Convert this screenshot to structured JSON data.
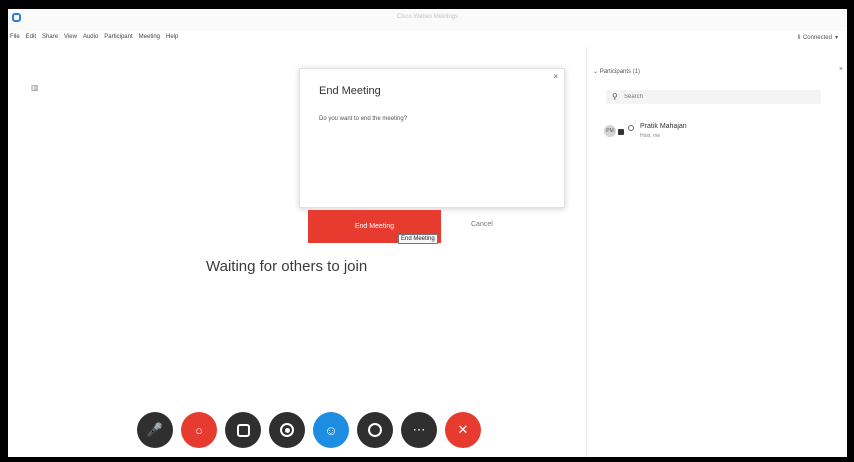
{
  "window": {
    "title": "Cisco Webex Meetings"
  },
  "menu": {
    "items": [
      "File",
      "Edit",
      "Share",
      "View",
      "Audio",
      "Participant",
      "Meeting",
      "Help"
    ]
  },
  "status": {
    "connected_label": "Connected"
  },
  "stage": {
    "waiting_text": "Waiting for others to join"
  },
  "dialog": {
    "title": "End Meeting",
    "message": "Do you want to end the meeting?",
    "primary_button": "End Meeting",
    "cancel_button": "Cancel",
    "tooltip": "End Meeting",
    "close_glyph": "×"
  },
  "controls": [
    {
      "name": "unmute-button",
      "icon": "mic-icon",
      "style": "dark"
    },
    {
      "name": "video-button",
      "icon": "video-off-icon",
      "style": "red"
    },
    {
      "name": "share-button",
      "icon": "share-icon",
      "style": "dark"
    },
    {
      "name": "record-button",
      "icon": "record-icon",
      "style": "dark"
    },
    {
      "name": "participants-button",
      "icon": "participants-icon",
      "style": "blue"
    },
    {
      "name": "chat-button",
      "icon": "chat-icon",
      "style": "dark"
    },
    {
      "name": "more-button",
      "icon": "more-icon",
      "style": "dark"
    },
    {
      "name": "end-meeting-button",
      "icon": "close-icon",
      "style": "red"
    }
  ],
  "panel": {
    "header": "Participants (1)",
    "close_glyph": "×",
    "search_placeholder": "Search",
    "participants": [
      {
        "name": "Pratik Mahajan",
        "role": "Host, me",
        "initials": "PM"
      }
    ]
  },
  "colors": {
    "accent_red": "#e73b30",
    "accent_blue": "#1c8de0",
    "control_dark": "#2f2f2f"
  }
}
